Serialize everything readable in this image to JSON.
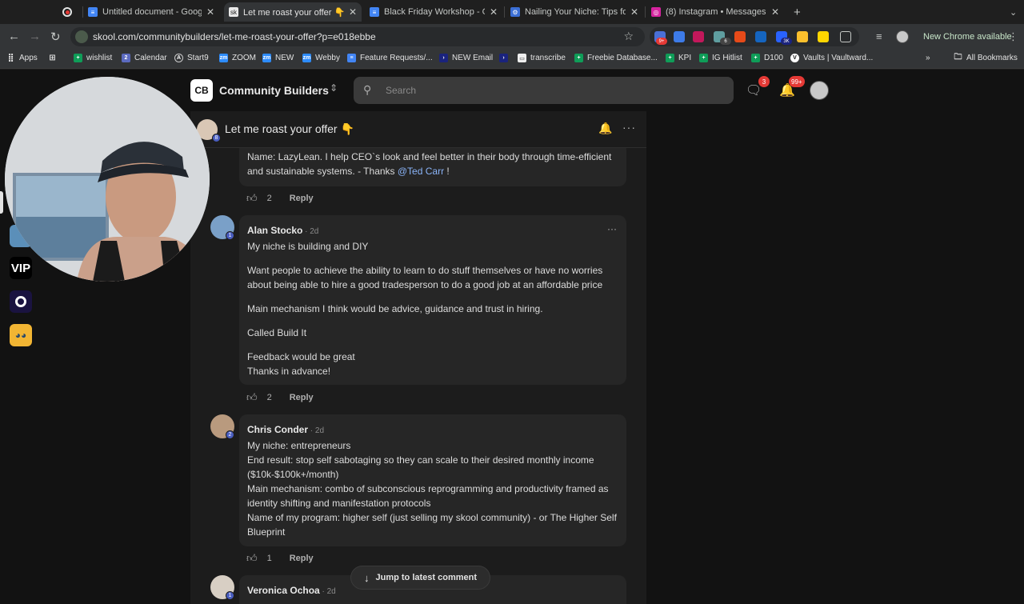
{
  "tabs": [
    {
      "title": "",
      "favicon": "record-icon",
      "active": false
    },
    {
      "title": "Untitled document - Google Docs",
      "favicon": "docs-icon",
      "active": false
    },
    {
      "title": "Let me roast your offer 👇 · Community Builders",
      "favicon": "skool-icon",
      "active": true
    },
    {
      "title": "Black Friday Workshop - Google Docs",
      "favicon": "docs-icon",
      "active": false
    },
    {
      "title": "Nailing Your Niche: Tips for Coaches",
      "favicon": "settings-icon",
      "active": false
    },
    {
      "title": "(8) Instagram • Messages",
      "favicon": "instagram-icon",
      "active": false
    }
  ],
  "toolbar": {
    "url": "skool.com/communitybuilders/let-me-roast-your-offer?p=e018ebbe",
    "new_chrome_label": "New Chrome available",
    "ext_badges": [
      "9+",
      "6",
      "3K"
    ]
  },
  "bookmarks": [
    {
      "label": "Apps",
      "icon": "apps-icon"
    },
    {
      "label": "",
      "icon": "grid-icon"
    },
    {
      "label": "wishlist",
      "icon": "sheets-icon"
    },
    {
      "label": "Calendar",
      "icon": "calendar-icon"
    },
    {
      "label": "Start9",
      "icon": "start9-icon"
    },
    {
      "label": "ZOOM",
      "icon": "zoom-icon"
    },
    {
      "label": "NEW",
      "icon": "zoom-icon"
    },
    {
      "label": "Webby",
      "icon": "zoom-icon"
    },
    {
      "label": "Feature Requests/...",
      "icon": "docs-icon"
    },
    {
      "label": "NEW Email",
      "icon": "arrow-icon"
    },
    {
      "label": "",
      "icon": "arrow-icon"
    },
    {
      "label": "transcribe",
      "icon": "page-icon"
    },
    {
      "label": "Freebie Database...",
      "icon": "sheets-icon"
    },
    {
      "label": "KPI",
      "icon": "sheets-icon"
    },
    {
      "label": "IG Hitlist",
      "icon": "sheets-icon"
    },
    {
      "label": "D100",
      "icon": "sheets-icon"
    },
    {
      "label": "Vaults | Vaultward...",
      "icon": "vault-icon"
    }
  ],
  "all_bookmarks_label": "All Bookmarks",
  "header": {
    "logo_text": "CB",
    "community_name": "Community Builders",
    "search_placeholder": "Search",
    "chat_badge": "3",
    "notif_badge": "99+"
  },
  "rail": {
    "vip_label": "VIP"
  },
  "post": {
    "title": "Let me roast your offer 👇",
    "author_level": "8"
  },
  "comments": [
    {
      "lines_p1": "Name: LazyLean. I help CEO`s look and feel better in their body through time-efficient and sustainable systems. - Thanks ",
      "mention": "@Ted Carr",
      "lines_p1_end": " !",
      "likes": "2",
      "reply_label": "Reply"
    },
    {
      "name": "Alan Stocko",
      "time": " · 2d",
      "level": "1",
      "p1": "My niche is building and DIY",
      "p2": "Want people to achieve the ability to learn to do stuff themselves or have no worries about being able to hire a good tradesperson to do a good job at an affordable price",
      "p3": "Main mechanism I think would be advice, guidance and trust in hiring.",
      "p4": "Called Build It",
      "p5": "Feedback would be great",
      "p6": "Thanks in advance!",
      "likes": "2",
      "reply_label": "Reply"
    },
    {
      "name": "Chris Conder",
      "time": " · 2d",
      "level": "2",
      "p1": "My niche: entrepreneurs",
      "p2": "End result: stop self sabotaging so they can scale to their desired monthly income ($10k-$100k+/month)",
      "p3": "Main mechanism: combo of subconscious reprogramming and productivity framed as identity shifting and manifestation protocols",
      "p4": "Name of my program: higher self (just selling my skool community) - or The Higher Self Blueprint",
      "likes": "1",
      "reply_label": "Reply"
    },
    {
      "name": "Veronica Ochoa",
      "time": " · 2d",
      "level": "1"
    }
  ],
  "jump_label": "Jump to latest comment"
}
